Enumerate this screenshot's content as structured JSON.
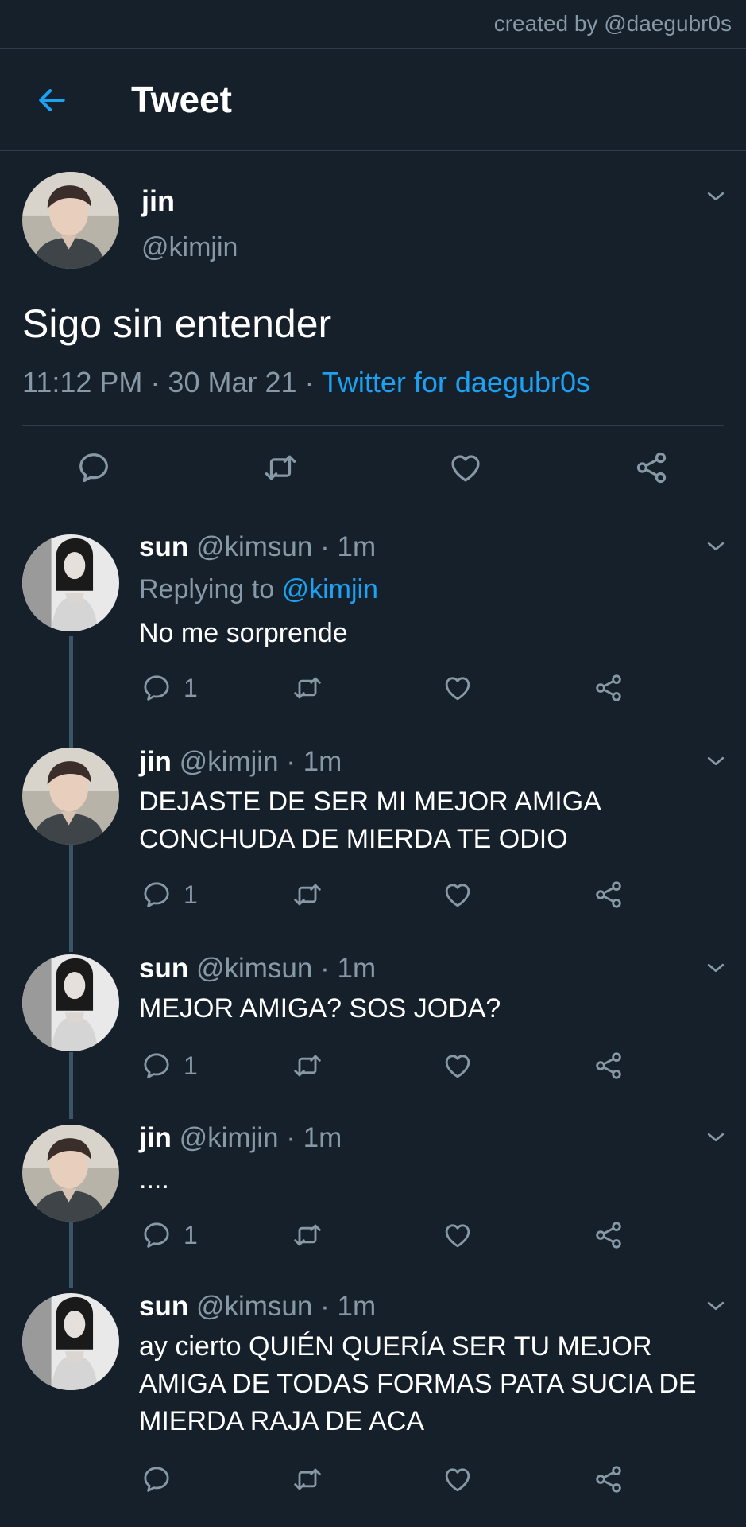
{
  "watermark": "created by @daegubr0s",
  "header": {
    "title": "Tweet"
  },
  "main_tweet": {
    "name": "jin",
    "handle": "@kimjin",
    "text": "Sigo sin entender",
    "time": "11:12 PM",
    "date": "30 Mar 21",
    "source": "Twitter for daegubr0s",
    "separator": " · "
  },
  "replies": [
    {
      "name": "sun",
      "handle": "@kimsun",
      "time": "· 1m",
      "replying_label": "Replying to",
      "replying_to": "@kimjin",
      "text": "No me sorprende",
      "reply_count": "1"
    },
    {
      "name": "jin",
      "handle": "@kimjin",
      "time": "· 1m",
      "text_lines": [
        "DEJASTE DE SER MI MEJOR AMIGA",
        "CONCHUDA DE MIERDA TE ODIO"
      ],
      "reply_count": "1"
    },
    {
      "name": "sun",
      "handle": "@kimsun",
      "time": "· 1m",
      "text": "MEJOR AMIGA? SOS JODA?",
      "reply_count": "1"
    },
    {
      "name": "jin",
      "handle": "@kimjin",
      "time": "· 1m",
      "text": "....",
      "reply_count": "1"
    },
    {
      "name": "sun",
      "handle": "@kimsun",
      "time": "· 1m",
      "text_lines": [
        "ay cierto QUIÉN QUERÍA SER TU MEJOR",
        "AMIGA DE TODAS FORMAS PATA SUCIA DE",
        "MIERDA RAJA DE ACA"
      ],
      "reply_count": ""
    }
  ],
  "colors": {
    "background": "#15202b",
    "accent": "#1da1f2",
    "muted": "#8899a6",
    "divider": "#2f3b47"
  },
  "icons": [
    "back-arrow-icon",
    "chevron-down-icon",
    "reply-icon",
    "retweet-icon",
    "like-icon",
    "share-icon"
  ]
}
